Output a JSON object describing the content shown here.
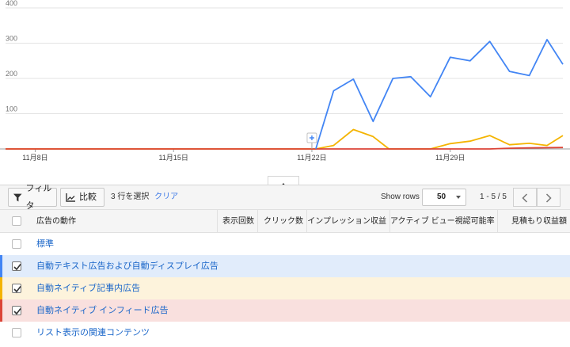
{
  "chart_data": {
    "type": "line",
    "y_ticks": [
      "400",
      "300",
      "200",
      "100"
    ],
    "x_tick_labels": [
      "11月8日",
      "11月15日",
      "11月22日",
      "11月29日"
    ],
    "x_tick_days": [
      0,
      7,
      14,
      21
    ],
    "x_range_days": [
      -1.5,
      26.7
    ],
    "ylim": [
      0,
      400
    ],
    "grid": true,
    "series": [
      {
        "color": "#4285f4",
        "values": [
          [
            14.2,
            0
          ],
          [
            15.1,
            165
          ],
          [
            16.1,
            198
          ],
          [
            17.1,
            78
          ],
          [
            18.1,
            200
          ],
          [
            19.0,
            205
          ],
          [
            20.0,
            148
          ],
          [
            21.0,
            260
          ],
          [
            22.0,
            250
          ],
          [
            23.0,
            305
          ],
          [
            24.0,
            220
          ],
          [
            25.0,
            208
          ],
          [
            25.9,
            310
          ],
          [
            26.7,
            240
          ]
        ]
      },
      {
        "color": "#f4b400",
        "values": [
          [
            -1.5,
            0
          ],
          [
            14.2,
            0
          ],
          [
            15.1,
            10
          ],
          [
            16.1,
            55
          ],
          [
            17.1,
            35
          ],
          [
            17.9,
            0
          ],
          [
            20.0,
            0
          ],
          [
            21.0,
            15
          ],
          [
            22.0,
            22
          ],
          [
            23.0,
            38
          ],
          [
            24.0,
            12
          ],
          [
            25.0,
            16
          ],
          [
            25.9,
            10
          ],
          [
            26.7,
            38
          ]
        ]
      },
      {
        "color": "#db4437",
        "values": [
          [
            -1.5,
            0
          ],
          [
            23.0,
            0
          ],
          [
            24.0,
            2
          ],
          [
            25.0,
            3
          ],
          [
            26.7,
            4
          ]
        ]
      }
    ],
    "annotation_day": 14
  },
  "toolbar": {
    "filter_label": "フィルタ",
    "compare_label": "比較",
    "selected_text": "3 行を選択",
    "clear_label": "クリア",
    "show_rows_label": "Show rows",
    "rows_value": "50",
    "pager_text": "1 - 5 / 5"
  },
  "table": {
    "columns": [
      "広告の動作",
      "表示回数",
      "クリック数",
      "インプレッション収益",
      "アクティブ ビュー視認可能率",
      "見積もり収益額"
    ],
    "rows": [
      {
        "label": "標準",
        "checked": false,
        "color": "",
        "bg": "#ffffff"
      },
      {
        "label": "自動テキスト広告および自動ディスプレイ広告",
        "checked": true,
        "color": "#4285f4",
        "bg": "#e1ecfb"
      },
      {
        "label": "自動ネイティブ記事内広告",
        "checked": true,
        "color": "#f4b400",
        "bg": "#fdf3dc"
      },
      {
        "label": "自動ネイティブ インフィード広告",
        "checked": true,
        "color": "#db4437",
        "bg": "#f9e0de"
      },
      {
        "label": "リスト表示の関連コンテンツ",
        "checked": false,
        "color": "",
        "bg": "#ffffff"
      }
    ]
  }
}
